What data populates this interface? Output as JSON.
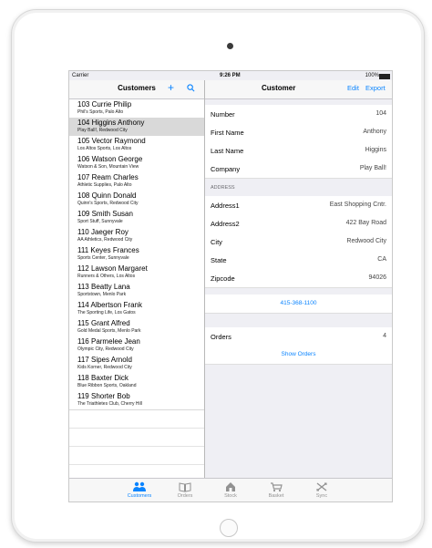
{
  "status_bar": {
    "carrier": "Carrier",
    "time": "9:26 PM",
    "battery": "100%"
  },
  "master": {
    "title": "Customers",
    "add_label": "+",
    "customers": [
      {
        "name": "103 Currie Philip",
        "sub": "Phil's Sports, Palo Alto"
      },
      {
        "name": "104 Higgins Anthony",
        "sub": "Play Ball!, Redwood City"
      },
      {
        "name": "105 Vector Raymond",
        "sub": "Los Altos Sports, Los Altos"
      },
      {
        "name": "106 Watson George",
        "sub": "Watson & Son, Mountain View"
      },
      {
        "name": "107 Ream Charles",
        "sub": "Athletic Supplies, Palo Alto"
      },
      {
        "name": "108 Quinn Donald",
        "sub": "Quinn's Sports, Redwood City"
      },
      {
        "name": "109 Smith Susan",
        "sub": "Sport Stuff, Sunnyvale"
      },
      {
        "name": "110 Jaeger Roy",
        "sub": "AA Athletics, Redwood City"
      },
      {
        "name": "111 Keyes Frances",
        "sub": "Sports Center, Sunnyvale"
      },
      {
        "name": "112 Lawson Margaret",
        "sub": "Runners & Others, Los Altos"
      },
      {
        "name": "113 Beatty Lana",
        "sub": "Sportstown, Menlo Park"
      },
      {
        "name": "114 Albertson Frank",
        "sub": "The Sporting Life, Los Gatos"
      },
      {
        "name": "115 Grant Alfred",
        "sub": "Gold Medal Sports, Menlo Park"
      },
      {
        "name": "116 Parmelee Jean",
        "sub": "Olympic City, Redwood City"
      },
      {
        "name": "117 Sipes Arnold",
        "sub": "Kids Korner, Redwood City"
      },
      {
        "name": "118 Baxter Dick",
        "sub": "Blue Ribbon Sports, Oakland"
      },
      {
        "name": "119 Shorter Bob",
        "sub": "The Triathletes Club, Cherry Hill"
      }
    ]
  },
  "detail": {
    "title": "Customer",
    "edit_label": "Edit",
    "export_label": "Export",
    "fields": [
      {
        "label": "Number",
        "value": "104"
      },
      {
        "label": "First Name",
        "value": "Anthony"
      },
      {
        "label": "Last Name",
        "value": "Higgins"
      },
      {
        "label": "Company",
        "value": "Play Ball!"
      }
    ],
    "address_header": "ADDRESS",
    "address": [
      {
        "label": "Address1",
        "value": "East Shopping Cntr."
      },
      {
        "label": "Address2",
        "value": "422 Bay Road"
      },
      {
        "label": "City",
        "value": "Redwood City"
      },
      {
        "label": "State",
        "value": "CA"
      },
      {
        "label": "Zipcode",
        "value": "94026"
      }
    ],
    "phone": "415-368-1100",
    "orders_label": "Orders",
    "orders_count": "4",
    "show_orders": "Show Orders"
  },
  "tabs": [
    {
      "label": "Customers",
      "icon": "people-icon",
      "active": true
    },
    {
      "label": "Orders",
      "icon": "book-icon",
      "active": false
    },
    {
      "label": "Stock",
      "icon": "house-icon",
      "active": false
    },
    {
      "label": "Basket",
      "icon": "cart-icon",
      "active": false
    },
    {
      "label": "Sync",
      "icon": "sync-icon",
      "active": false
    }
  ],
  "colors": {
    "accent": "#0a84ff",
    "selected_row": "#d9d9d9",
    "background": "#efeff4"
  }
}
